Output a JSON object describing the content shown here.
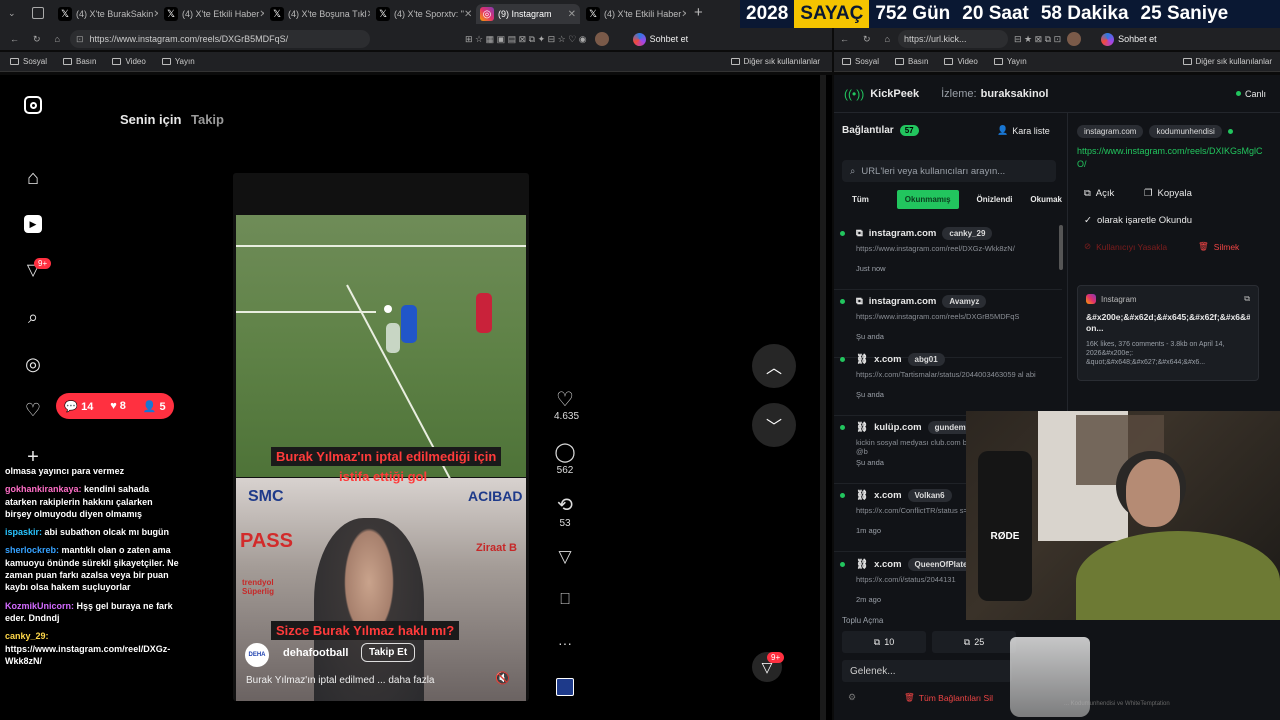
{
  "tabs": [
    {
      "label": "(4) X'te BurakSakin",
      "active": false
    },
    {
      "label": "(4) X'te Etkili Haber",
      "active": false
    },
    {
      "label": "(4) X'te Boşuna Tıkl",
      "active": false
    },
    {
      "label": "(4) X'te Sporxtv: \"",
      "active": false
    },
    {
      "label": "(9) Instagram",
      "active": true
    },
    {
      "label": "(4) X'te Etkili Haber",
      "active": false
    }
  ],
  "counter": {
    "year": "2028",
    "label": "SAYAÇ",
    "days": "752 Gün",
    "hours": "20 Saat",
    "minutes": "58 Dakika",
    "seconds": "25 Saniye"
  },
  "left_browser": {
    "url": "https://www.instagram.com/reels/DXGrB5MDFqS/",
    "bookmarks": [
      "Sosyal",
      "Basın",
      "Video",
      "Yayın"
    ],
    "other_bookmarks": "Diğer sık kullanılanlar",
    "chat_button": "Sohbet et"
  },
  "right_browser": {
    "url": "https://url.kick...",
    "bookmarks": [
      "Sosyal",
      "Basın",
      "Video",
      "Yayın"
    ],
    "other_bookmarks": "Diğer sık kullanılanlar",
    "chat_button": "Sohbet et"
  },
  "instagram": {
    "tab_for_you": "Senin için",
    "tab_follow": "Takip",
    "notif_badge": "9+",
    "overlay": {
      "comments": "14",
      "likes": "8",
      "follows": "5"
    },
    "caption_top_1": "Burak Yılmaz'ın iptal edilmediği için",
    "caption_top_2": "istifa ettiği gol",
    "caption_bottom": "Sizce Burak Yılmaz haklı mı?",
    "account": "dehafootball",
    "follow_button": "Takip Et",
    "description": "Burak Yılmaz'ın iptal edilmed ... daha fazla",
    "likes": "4.635",
    "comments": "562",
    "reposts": "53",
    "dm_badge": "9+",
    "board": [
      "SMC",
      "PASS",
      "ACIBAD",
      "Ziraat B",
      "trendyol Süperlig"
    ]
  },
  "chat": [
    {
      "user": "",
      "text": "olmasa yayıncı para vermez"
    },
    {
      "user": "gokhankirankaya:",
      "text": "kendini sahada atarken rakiplerin hakkını çalarken birşey olmuyodu diyen olmamış"
    },
    {
      "user": "ispaskir:",
      "text": "abi subathon olcak mı bugün"
    },
    {
      "user": "sherlockreb:",
      "text": "mantıklı olan o zaten ama kamuoyu önünde sürekli şikayetçiler. Ne zaman puan farkı azalsa veya bir puan kaybı olsa hakem suçluyorlar"
    },
    {
      "user": "KozmikUnicorn:",
      "text": "Hşş gel buraya ne fark eder. Dndndj"
    },
    {
      "user": "canky_29:",
      "text": "https://www.instagram.com/reel/DXGz-Wkk8zN/"
    }
  ],
  "kickpeek": {
    "app": "KickPeek",
    "watching_label": "İzleme:",
    "watching": "buraksakinol",
    "live": "Canlı",
    "connections": "Bağlantılar",
    "conn_count": "57",
    "blacklist": "Kara liste",
    "search_placeholder": "URL'leri veya kullanıcıları arayın...",
    "filters": [
      "Tüm",
      "Okunmamış",
      "Önizlendi",
      "Okumak"
    ],
    "items": [
      {
        "site": "instagram.com",
        "user": "canky_29",
        "url": "https://www.instagram.com/reel/DXGz-Wkk8zN/",
        "time": "Just now"
      },
      {
        "site": "instagram.com",
        "user": "Avamyz",
        "url": "https://www.instagram.com/reels/DXGrB5MDFqS",
        "time": "Şu anda"
      },
      {
        "site": "x.com",
        "user": "abg01",
        "url": "https://x.com/Tartismalar/status/2044003463059 al abi",
        "time": "Şu anda"
      },
      {
        "site": "kulüp.com",
        "user": "gundemy",
        "url": "kickin sosyal medyası club.com beklerim https://club.com/ @b",
        "time": "Şu anda"
      },
      {
        "site": "x.com",
        "user": "Volkan6",
        "url": "https://x.com/ConflictTR/status s=20",
        "time": "1m ago"
      },
      {
        "site": "x.com",
        "user": "QueenOfPlates",
        "url": "https://x.com/i/status/2044131",
        "time": "2m ago"
      }
    ],
    "detail": {
      "site": "instagram.com",
      "user": "kodumunhendisi",
      "url": "https://www.instagram.com/reels/DXIKGsMglCO/",
      "open": "Açık",
      "copy": "Kopyala",
      "mark_read": "olarak işaretle Okundu",
      "ban": "Kullanıcıyı Yasakla",
      "delete": "Silmek",
      "preview_source": "Instagram",
      "preview_title": "&#x200e;&#x62d;&#x645;&#x62f;&#x6&#x1f1ee;&#x1f1f9;&#x200e; on...",
      "preview_meta": "16K likes, 376 comments - 3.8kb on April 14, 2026&#x200e;: &quot;&#x648;&#x627;&#x644;&#x6..."
    },
    "bulk_open": "Toplu Açma",
    "bulk_10": "10",
    "bulk_25": "25",
    "incoming": "Gelenek...",
    "clear_all": "Tüm Bağlantıları Sil",
    "footer": "... Kodumunhendisi ve WhiteTemptation"
  },
  "webcam": {
    "mic_brand": "RØDE"
  }
}
